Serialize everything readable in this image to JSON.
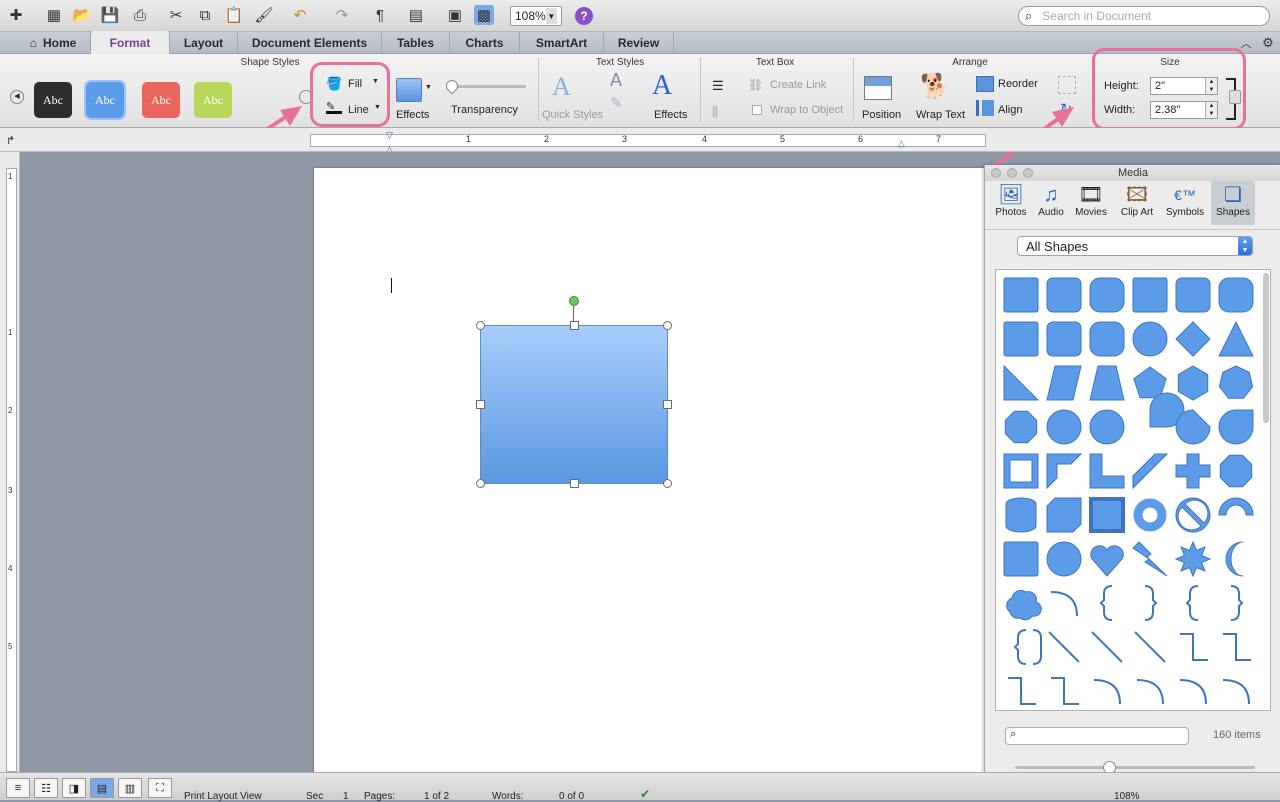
{
  "toolbar": {
    "zoom": "108%",
    "search_placeholder": "Search in Document",
    "help_label": "?",
    "paragraph_mark": "¶"
  },
  "tabs": [
    "Home",
    "Format",
    "Layout",
    "Document Elements",
    "Tables",
    "Charts",
    "SmartArt",
    "Review"
  ],
  "ribbon": {
    "groups": {
      "shape_styles": "Shape Styles",
      "text_styles": "Text Styles",
      "text_box": "Text Box",
      "arrange": "Arrange",
      "size": "Size"
    },
    "style_sample": "Abc",
    "style_colors": [
      "#2d2d2d",
      "#5b9be8",
      "#e8665e",
      "#b7d65a"
    ],
    "fill_label": "Fill",
    "line_label": "Line",
    "effects_label": "Effects",
    "transparency_label": "Transparency",
    "transparency_value": 0,
    "quick_styles_label": "Quick Styles",
    "text_effects_label": "Effects",
    "create_link_label": "Create Link",
    "wrap_to_object_label": "Wrap to Object",
    "position_label": "Position",
    "wrap_text_label": "Wrap Text",
    "reorder_label": "Reorder",
    "align_label": "Align",
    "height_label": "Height:",
    "height_value": "2\"",
    "width_label": "Width:",
    "width_value": "2.38\"",
    "highlight_color": "#e8719a"
  },
  "ruler": {
    "numbers": [
      "1",
      "2",
      "3",
      "4",
      "5",
      "6",
      "7"
    ],
    "vertical_numbers": [
      "1",
      "1",
      "2",
      "3",
      "4",
      "5"
    ]
  },
  "media": {
    "title": "Media",
    "tabs": [
      "Photos",
      "Audio",
      "Movies",
      "Clip Art",
      "Symbols",
      "Shapes"
    ],
    "active_tab": "Shapes",
    "dropdown": "All Shapes",
    "item_count": "160 items",
    "shape_color": "#5b9be8"
  },
  "status": {
    "view": "Print Layout View",
    "sec_label": "Sec",
    "sec_value": "1",
    "pages_label": "Pages:",
    "pages_value": "1 of 2",
    "words_label": "Words:",
    "words_value": "0 of 0",
    "zoom": "108%"
  }
}
